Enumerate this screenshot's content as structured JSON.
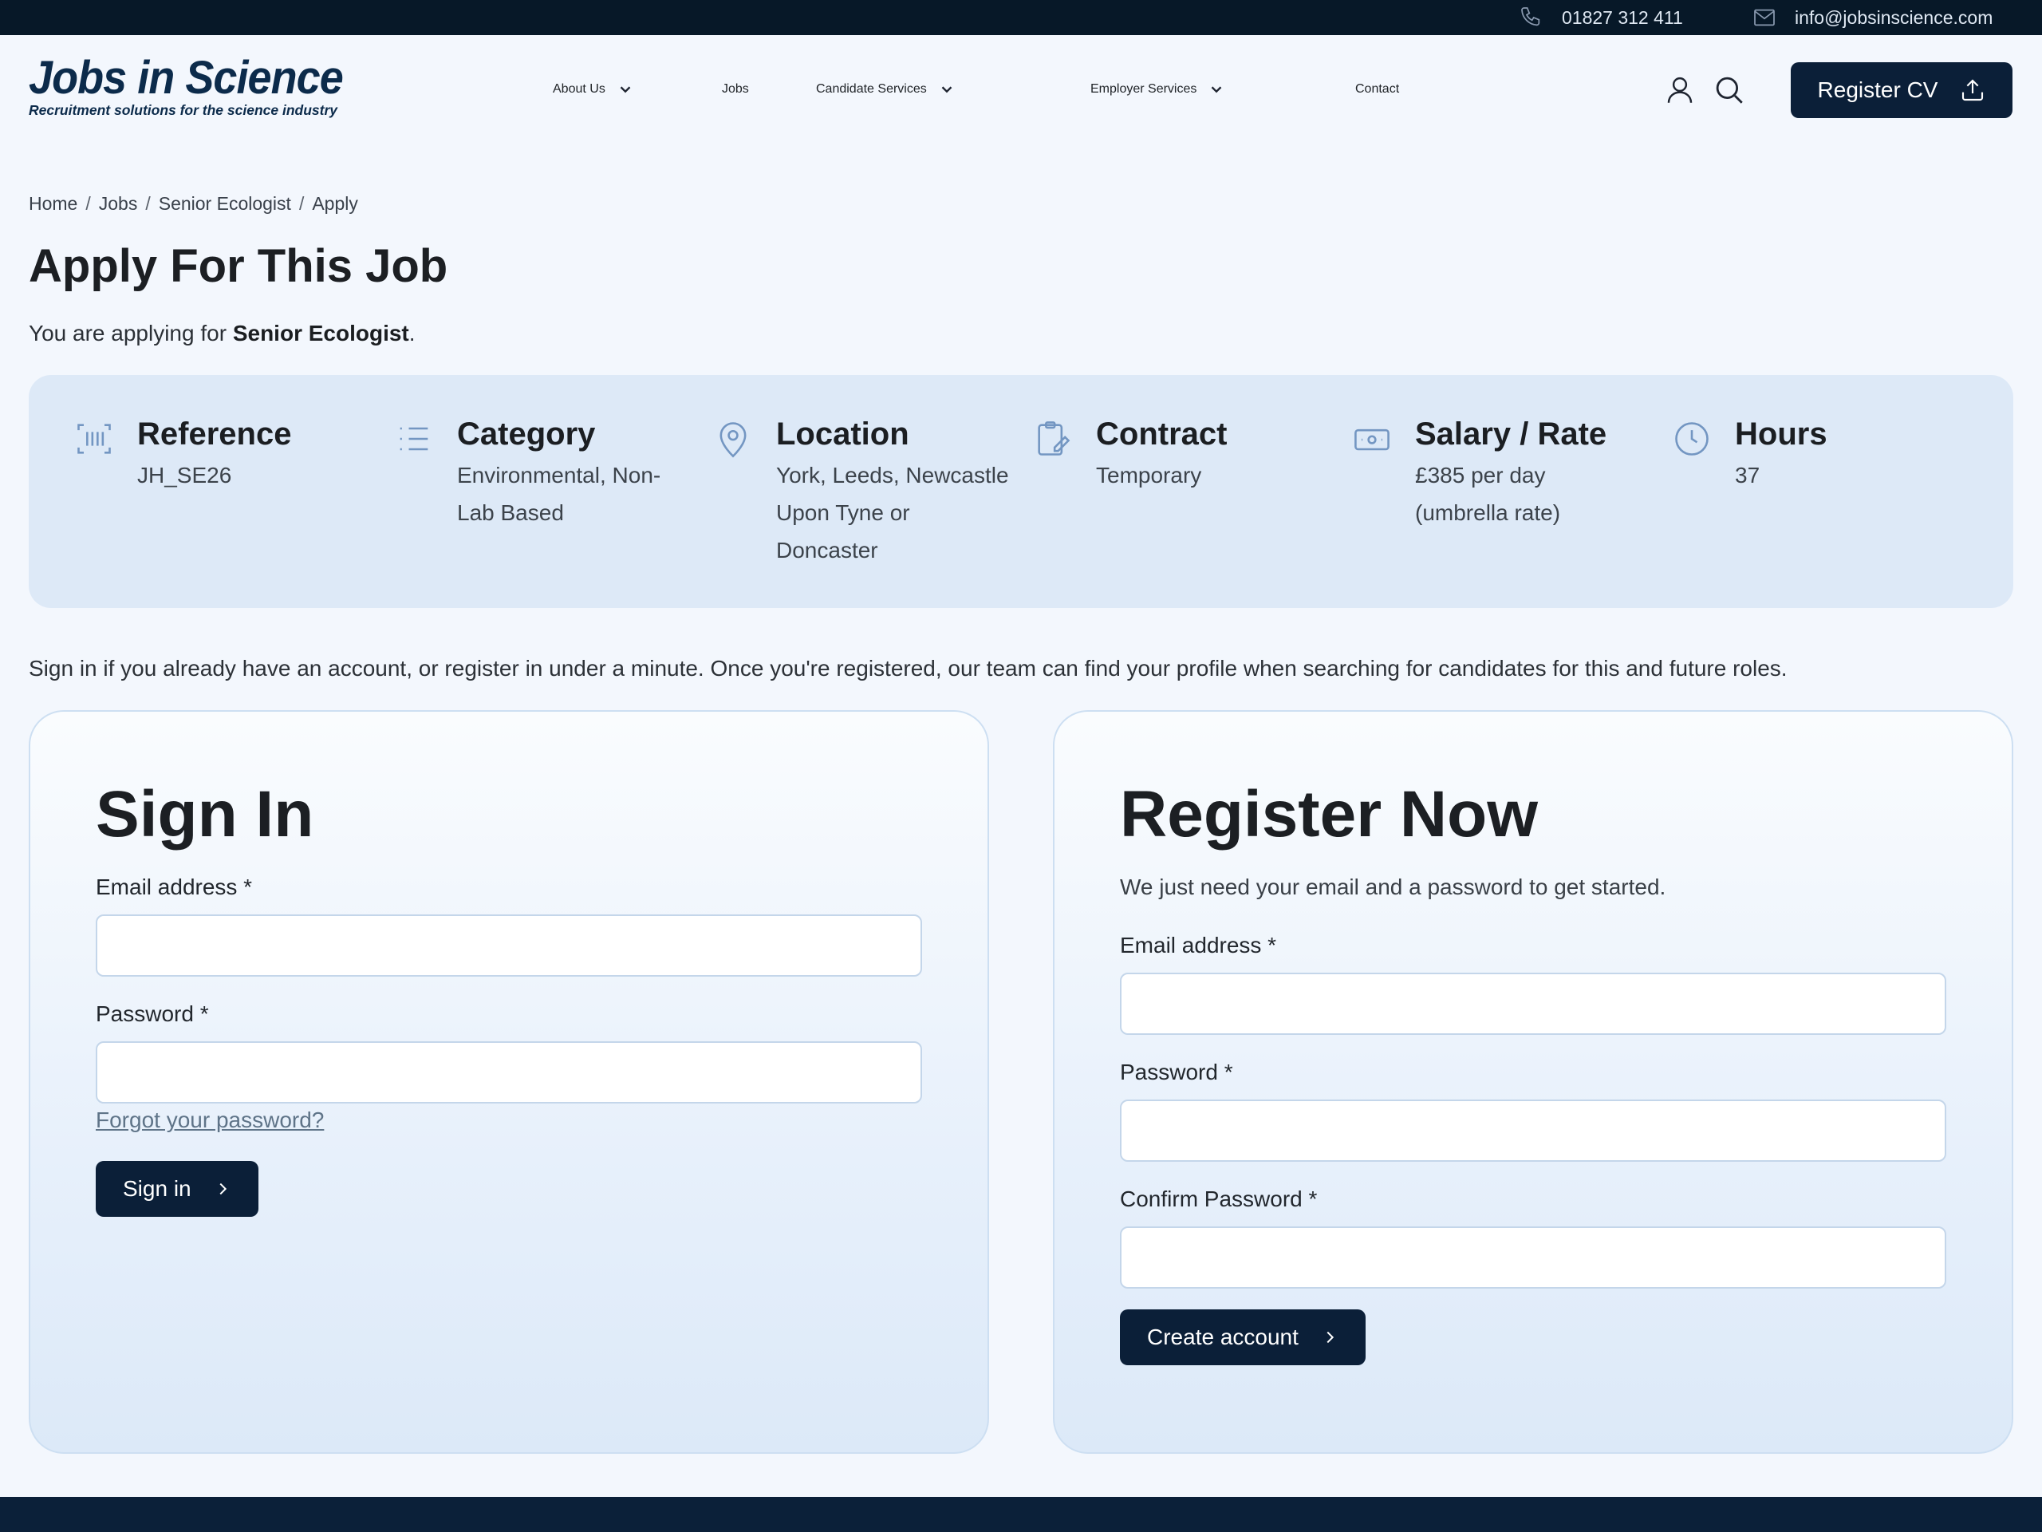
{
  "topbar": {
    "phone": "01827 312 411",
    "email": "info@jobsinscience.com",
    "phone_icon": "phone-icon",
    "email_icon": "mail-icon"
  },
  "header": {
    "logo_title": "Jobs in Science",
    "logo_tagline": "Recruitment solutions for the science industry",
    "nav": [
      {
        "label": "About Us",
        "dropdown": true
      },
      {
        "label": "Jobs",
        "dropdown": false
      },
      {
        "label": "Candidate Services",
        "dropdown": true
      },
      {
        "label": "Employer Services",
        "dropdown": true
      },
      {
        "label": "Contact",
        "dropdown": false
      }
    ],
    "register_cv_label": "Register CV",
    "account_icon": "user-icon",
    "search_icon": "search-icon",
    "upload_icon": "upload-icon"
  },
  "breadcrumb": [
    "Home",
    "Jobs",
    "Senior Ecologist",
    "Apply"
  ],
  "page": {
    "title": "Apply For This Job",
    "applying_prefix": "You are applying for ",
    "job_title": "Senior Ecologist",
    "applying_suffix": "."
  },
  "job_details": [
    {
      "label": "Reference",
      "value": "JH_SE26",
      "icon": "barcode-icon"
    },
    {
      "label": "Category",
      "value": "Environmental, Non-Lab Based",
      "icon": "list-icon"
    },
    {
      "label": "Location",
      "value": "York, Leeds, Newcastle Upon Tyne or Doncaster",
      "icon": "location-pin-icon"
    },
    {
      "label": "Contract",
      "value": "Temporary",
      "icon": "clipboard-icon"
    },
    {
      "label": "Salary / Rate",
      "value": "£385 per day (umbrella rate)",
      "icon": "money-icon"
    },
    {
      "label": "Hours",
      "value": "37",
      "icon": "clock-icon"
    }
  ],
  "intro_text": "Sign in if you already have an account, or register in under a minute. Once you're registered, our team can find your profile when searching for candidates for this and future roles.",
  "signin": {
    "title": "Sign In",
    "email_label": "Email address *",
    "password_label": "Password *",
    "forgot_label": "Forgot your password?",
    "button_label": "Sign in",
    "email_value": "",
    "password_value": ""
  },
  "register": {
    "title": "Register Now",
    "description": "We just need your email and a password to get started.",
    "email_label": "Email address *",
    "password_label": "Password *",
    "confirm_label": "Confirm Password *",
    "button_label": "Create account",
    "email_value": "",
    "password_value": "",
    "confirm_value": ""
  },
  "colors": {
    "primary_dark": "#0b1f38",
    "topbar_bg": "#071828",
    "page_bg": "#f3f7fd",
    "panel_bg": "#dde9f7",
    "icon_blue": "#7396c2",
    "link": "#5f7488"
  }
}
